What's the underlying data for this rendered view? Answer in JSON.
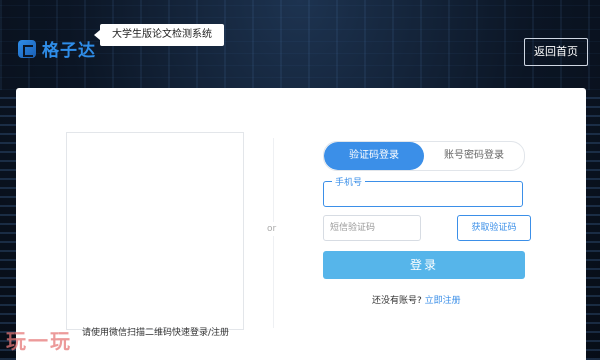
{
  "header": {
    "logo_text": "格子达",
    "tag_text": "大学生版论文检测系统",
    "home_button": "返回首页"
  },
  "qr": {
    "hint": "请使用微信扫描二维码快速登录/注册"
  },
  "divider": {
    "or_text": "or"
  },
  "login": {
    "tabs": [
      {
        "label": "验证码登录",
        "active": true
      },
      {
        "label": "账号密码登录",
        "active": false
      }
    ],
    "phone_label": "手机号",
    "phone_value": "",
    "code_placeholder": "短信验证码",
    "get_code_label": "获取验证码",
    "submit_label": "登录",
    "register_prompt": "还没有账号?",
    "register_link": "立即注册"
  },
  "watermark": {
    "text": "玩一玩"
  },
  "colors": {
    "accent": "#3b8fe8",
    "submit": "#56b5ea"
  }
}
